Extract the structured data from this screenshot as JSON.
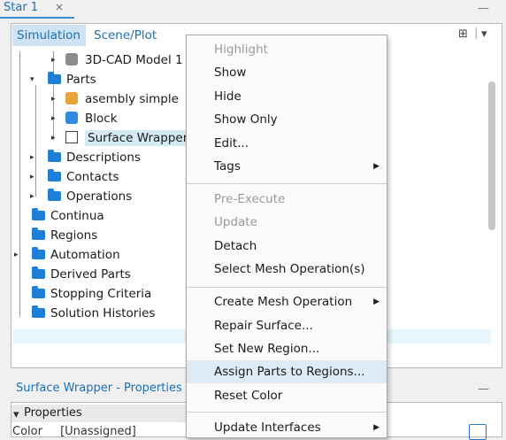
{
  "window": {
    "tab_title": "Star 1",
    "close_glyph": "×",
    "minimize_glyph": "—"
  },
  "tree_tabs": {
    "simulation": "Simulation",
    "scene_plot": "Scene/Plot"
  },
  "tree": {
    "cad_model": "3D-CAD Model 1",
    "parts": "Parts",
    "asembly": "asembly simple",
    "block": "Block",
    "surface_wrapper": "Surface Wrapper",
    "descriptions": "Descriptions",
    "contacts": "Contacts",
    "operations": "Operations",
    "continua": "Continua",
    "regions": "Regions",
    "automation": "Automation",
    "derived_parts": "Derived Parts",
    "stopping_criteria": "Stopping Criteria",
    "solution_histories": "Solution Histories"
  },
  "menu": {
    "highlight": "Highlight",
    "show": "Show",
    "hide": "Hide",
    "show_only": "Show Only",
    "edit": "Edit...",
    "tags": "Tags",
    "pre_execute": "Pre-Execute",
    "update": "Update",
    "detach": "Detach",
    "select_mesh_ops": "Select Mesh Operation(s)",
    "create_mesh_op": "Create Mesh Operation",
    "repair_surface": "Repair Surface...",
    "set_new_region": "Set New Region...",
    "assign_parts": "Assign Parts to Regions...",
    "reset_color": "Reset Color",
    "update_interfaces": "Update Interfaces"
  },
  "properties": {
    "title": "Surface Wrapper - Properties",
    "section": "Properties",
    "row_label": "Color",
    "row_value": "[Unassigned]"
  },
  "colors": {
    "accent_blue": "#1c6fb5",
    "folder_blue": "#1f7fd6",
    "highlight": "#dcebf5",
    "selected_row": "#d6eaf5"
  }
}
